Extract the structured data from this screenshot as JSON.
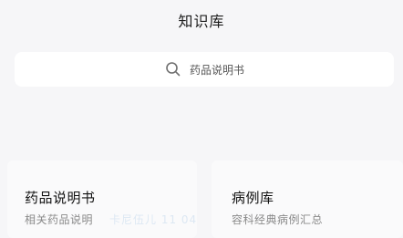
{
  "header": {
    "title": "知识库"
  },
  "search": {
    "icon": "search-icon",
    "placeholder": "药品说明书"
  },
  "cards": [
    {
      "title": "药品说明书",
      "subtitle": "相关药品说明"
    },
    {
      "title": "病例库",
      "subtitle": "容科经典病例汇总"
    }
  ],
  "watermark": "卡尼伍儿 11 04"
}
